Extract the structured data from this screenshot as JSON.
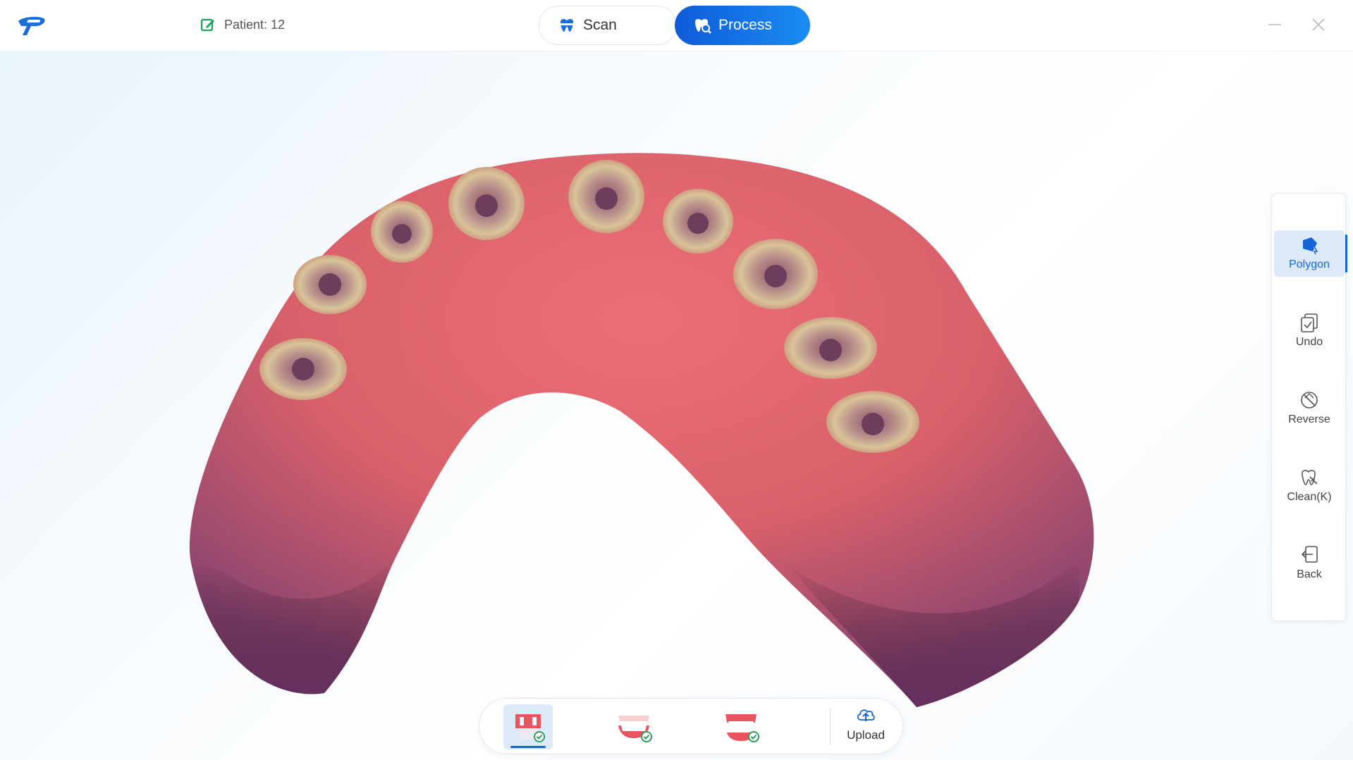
{
  "header": {
    "patient_label": "Patient: 12",
    "tabs": [
      {
        "label": "Scan",
        "icon": "tooth-scan-icon",
        "active": false
      },
      {
        "label": "Process",
        "icon": "tooth-process-icon",
        "active": true
      }
    ]
  },
  "toolbar": {
    "items": [
      {
        "label": "Polygon",
        "icon": "polygon-select-icon",
        "active": true
      },
      {
        "label": "Undo",
        "icon": "undo-icon",
        "active": false
      },
      {
        "label": "Reverse",
        "icon": "reverse-icon",
        "active": false
      },
      {
        "label": "Clean(K)",
        "icon": "clean-icon",
        "active": false
      },
      {
        "label": "Back",
        "icon": "back-icon",
        "active": false
      }
    ]
  },
  "bottombar": {
    "steps": [
      {
        "icon": "implant-jaw-icon",
        "active": true,
        "done": true
      },
      {
        "icon": "upper-jaw-icon",
        "active": false,
        "done": true
      },
      {
        "icon": "lower-jaw-icon",
        "active": false,
        "done": true
      }
    ],
    "upload_label": "Upload"
  },
  "colors": {
    "accent": "#1565d8",
    "gum": "#d9606a",
    "gum_dark": "#7a3f6b"
  }
}
